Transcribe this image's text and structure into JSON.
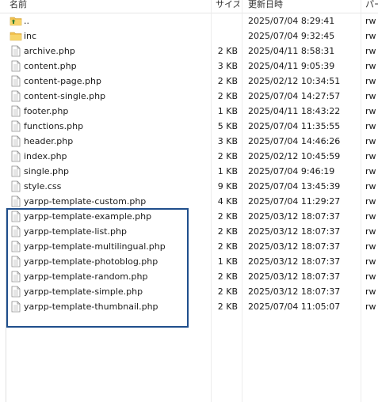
{
  "columns": {
    "name": "名前",
    "size": "サイズ",
    "modified": "更新日時",
    "permissions": "パー"
  },
  "files": [
    {
      "name": "..",
      "type": "parent",
      "size": "",
      "modified": "2025/07/04 8:29:41",
      "perm": "rw"
    },
    {
      "name": "inc",
      "type": "folder",
      "size": "",
      "modified": "2025/07/04 9:32:45",
      "perm": "rw"
    },
    {
      "name": "archive.php",
      "type": "file",
      "size": "2 KB",
      "modified": "2025/04/11 8:58:31",
      "perm": "rw"
    },
    {
      "name": "content.php",
      "type": "file",
      "size": "3 KB",
      "modified": "2025/04/11 9:05:39",
      "perm": "rw"
    },
    {
      "name": "content-page.php",
      "type": "file",
      "size": "2 KB",
      "modified": "2025/02/12 10:34:51",
      "perm": "rw"
    },
    {
      "name": "content-single.php",
      "type": "file",
      "size": "2 KB",
      "modified": "2025/07/04 14:27:57",
      "perm": "rw"
    },
    {
      "name": "footer.php",
      "type": "file",
      "size": "1 KB",
      "modified": "2025/04/11 18:43:22",
      "perm": "rw"
    },
    {
      "name": "functions.php",
      "type": "file",
      "size": "5 KB",
      "modified": "2025/07/04 11:35:55",
      "perm": "rw"
    },
    {
      "name": "header.php",
      "type": "file",
      "size": "3 KB",
      "modified": "2025/07/04 14:46:26",
      "perm": "rw"
    },
    {
      "name": "index.php",
      "type": "file",
      "size": "2 KB",
      "modified": "2025/02/12 10:45:59",
      "perm": "rw"
    },
    {
      "name": "single.php",
      "type": "file",
      "size": "1 KB",
      "modified": "2025/07/04 9:46:19",
      "perm": "rw"
    },
    {
      "name": "style.css",
      "type": "file",
      "size": "9 KB",
      "modified": "2025/07/04 13:45:39",
      "perm": "rw"
    },
    {
      "name": "yarpp-template-custom.php",
      "type": "file",
      "size": "4 KB",
      "modified": "2025/07/04 11:29:27",
      "perm": "rw"
    },
    {
      "name": "yarpp-template-example.php",
      "type": "file",
      "size": "2 KB",
      "modified": "2025/03/12 18:07:37",
      "perm": "rw"
    },
    {
      "name": "yarpp-template-list.php",
      "type": "file",
      "size": "2 KB",
      "modified": "2025/03/12 18:07:37",
      "perm": "rw"
    },
    {
      "name": "yarpp-template-multilingual.php",
      "type": "file",
      "size": "2 KB",
      "modified": "2025/03/12 18:07:37",
      "perm": "rw"
    },
    {
      "name": "yarpp-template-photoblog.php",
      "type": "file",
      "size": "1 KB",
      "modified": "2025/03/12 18:07:37",
      "perm": "rw"
    },
    {
      "name": "yarpp-template-random.php",
      "type": "file",
      "size": "2 KB",
      "modified": "2025/03/12 18:07:37",
      "perm": "rw"
    },
    {
      "name": "yarpp-template-simple.php",
      "type": "file",
      "size": "2 KB",
      "modified": "2025/03/12 18:07:37",
      "perm": "rw"
    },
    {
      "name": "yarpp-template-thumbnail.php",
      "type": "file",
      "size": "2 KB",
      "modified": "2025/07/04 11:05:07",
      "perm": "rw"
    }
  ],
  "highlight_color": "#1f4e8c",
  "folder_color": "#f2c14e",
  "parent_arrow_color": "#2e7d32"
}
